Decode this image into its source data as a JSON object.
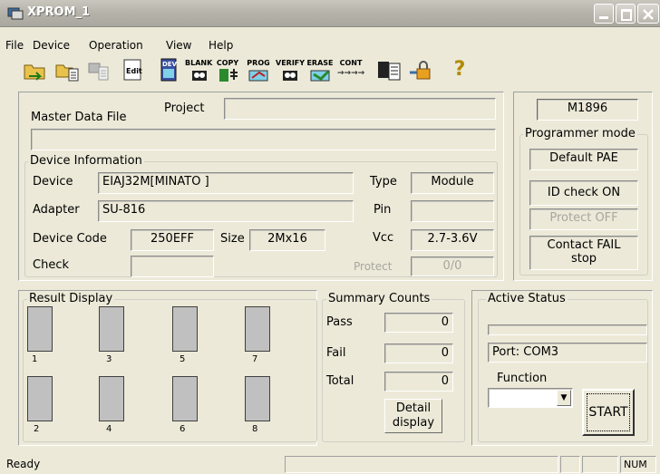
{
  "window": {
    "title": "XPROM_1"
  },
  "menu": [
    "File",
    "Device",
    "Operation",
    "View",
    "Help"
  ],
  "toolbar": {
    "edit": "Edit",
    "dev": "DEV",
    "blank": "BLANK",
    "copy": "COPY",
    "prog": "PROG",
    "verify": "VERIFY",
    "erase": "ERASE",
    "cont": "CONT",
    "cont_arrows": "→→→→",
    "help": "?"
  },
  "project": {
    "label": "Project",
    "value": ""
  },
  "master_data_file": {
    "label": "Master Data File",
    "value": ""
  },
  "device_info": {
    "group_label": "Device Information",
    "device_label": "Device",
    "device_value": "EIAJ32M[MINATO ]",
    "type_label": "Type",
    "type_value": "Module",
    "adapter_label": "Adapter",
    "adapter_value": "SU-816",
    "pin_label": "Pin",
    "pin_value": "",
    "device_code_label": "Device Code",
    "device_code_value": "250EFF",
    "size_label": "Size",
    "size_value": "2Mx16",
    "vcc_label": "Vcc",
    "vcc_value": "2.7-3.6V",
    "check_label": "Check",
    "check_value": "",
    "protect_label": "Protect",
    "protect_value": "0/0"
  },
  "programmer": {
    "model": "M1896",
    "mode_label": "Programmer mode",
    "default_pae": "Default PAE",
    "id_check": "ID check ON",
    "protect_off": "Protect OFF",
    "contact_fail": "Contact FAIL stop"
  },
  "result_display": {
    "label": "Result Display",
    "slots": [
      "1",
      "3",
      "5",
      "7",
      "2",
      "4",
      "6",
      "8"
    ]
  },
  "summary": {
    "label": "Summary Counts",
    "pass_label": "Pass",
    "pass_value": "0",
    "fail_label": "Fail",
    "fail_value": "0",
    "total_label": "Total",
    "total_value": "0",
    "detail_button": "Detail display"
  },
  "active_status": {
    "label": "Active Status",
    "port": "Port: COM3",
    "function_label": "Function",
    "function_value": "",
    "start_button": "START"
  },
  "statusbar": {
    "ready": "Ready",
    "num": "NUM"
  }
}
